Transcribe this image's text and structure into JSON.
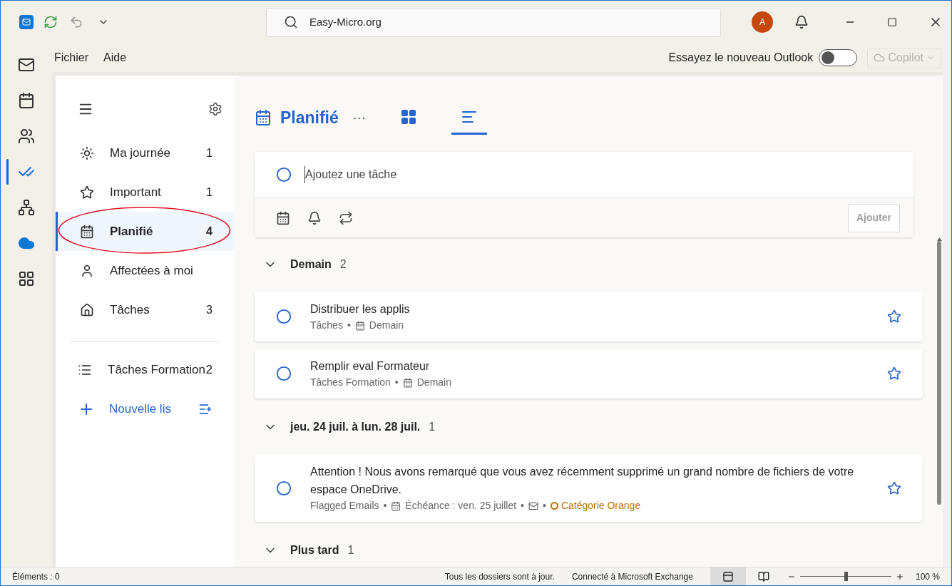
{
  "title_bar": {
    "search_value": "Easy-Micro.org",
    "avatar": "A"
  },
  "menu": [
    "Fichier",
    "Aide"
  ],
  "new_outlook": {
    "label": "Essayez le nouveau Outlook",
    "on": false
  },
  "copilot": {
    "label": "Copilot",
    "disabled": true
  },
  "app_rail": [
    {
      "kind": "mail",
      "selected": false
    },
    {
      "kind": "calendar",
      "selected": false
    },
    {
      "kind": "people",
      "selected": false
    },
    {
      "kind": "todo",
      "selected": true
    },
    {
      "kind": "groups",
      "selected": false
    },
    {
      "kind": "cloud",
      "selected": false
    },
    {
      "kind": "apps",
      "selected": false
    }
  ],
  "sidebar": {
    "items": [
      {
        "kind": "sun",
        "label": "Ma journée",
        "count": "1",
        "selected": false
      },
      {
        "kind": "star",
        "label": "Important",
        "count": "1",
        "selected": false
      },
      {
        "kind": "calendar",
        "label": "Planifié",
        "count": "4",
        "selected": true,
        "annotated": true
      },
      {
        "kind": "person",
        "label": "Affectées à moi",
        "selected": false
      },
      {
        "kind": "home",
        "label": "Tâches",
        "count": "3",
        "selected": false
      }
    ],
    "lists": [
      {
        "label": "Tâches Formation",
        "count": "2"
      }
    ],
    "new_list": "Nouvelle lis"
  },
  "header": {
    "title": "Planifié",
    "more": "···",
    "views": [
      {
        "kind": "grid",
        "selected": false
      },
      {
        "kind": "list",
        "selected": true
      }
    ]
  },
  "add_task": {
    "placeholder": "Ajoutez une tâche",
    "button": "Ajouter"
  },
  "groups": [
    {
      "title": "Demain",
      "count": "2",
      "expanded": true,
      "tasks": [
        {
          "title": "Distribuer les applis",
          "starred": false,
          "meta": [
            {
              "kind": "text",
              "text": "Tâches"
            },
            {
              "kind": "date",
              "sep": "•",
              "text": "Demain"
            }
          ]
        },
        {
          "title": "Remplir eval Formateur",
          "starred": false,
          "meta": [
            {
              "kind": "text",
              "text": "Tâches Formation"
            },
            {
              "kind": "date",
              "sep": "•",
              "text": "Demain"
            }
          ]
        }
      ]
    },
    {
      "title": "jeu. 24 juil. à lun. 28 juil.",
      "count": "1",
      "expanded": true,
      "tasks": [
        {
          "title": "Attention ! Nous avons remarqué que vous avez récemment supprimé un grand nombre de fichiers de votre espace OneDrive.",
          "starred": false,
          "meta": [
            {
              "kind": "text",
              "text": "Flagged Emails"
            },
            {
              "kind": "date",
              "sep": "•",
              "text": "Échéance : ven. 25 juillet"
            },
            {
              "kind": "mail",
              "sep": "•"
            },
            {
              "kind": "category",
              "sep": "•",
              "text": "Catégorie Orange",
              "color": "#b86e00"
            }
          ]
        }
      ]
    },
    {
      "title": "Plus tard",
      "count": "1",
      "expanded": true
    }
  ],
  "status_bar": {
    "items": "Éléments : 0",
    "sync": "Tous les dossiers sont à jour.",
    "connection": "Connecté à Microsoft Exchange",
    "zoom": "100 %",
    "level": 0.5,
    "views": [
      {
        "kind": "normal",
        "selected": true
      },
      {
        "kind": "reading",
        "selected": false
      }
    ]
  }
}
